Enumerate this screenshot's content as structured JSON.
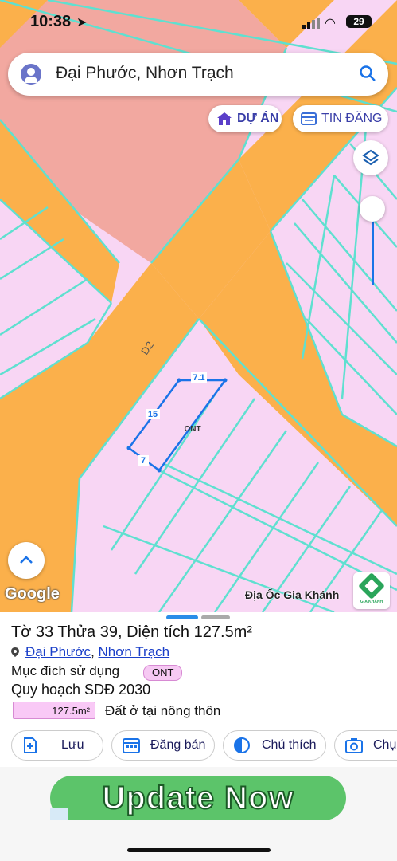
{
  "status_bar": {
    "time": "10:38",
    "battery": "29"
  },
  "search": {
    "query": "Đại Phước, Nhơn Trạch"
  },
  "pills": {
    "project": "DỰ ÁN",
    "listing": "TIN ĐĂNG"
  },
  "map": {
    "road_label": "D2",
    "plot_edges": {
      "top": "7.1",
      "left": "15",
      "bottom": "7"
    },
    "plot_code": "ONT",
    "attribution": "Google",
    "credit": "Địa Ốc Gia Khánh",
    "logo_caption": "GIA KHÁNH"
  },
  "info": {
    "title": "Tờ 33 Thửa 39, Diện tích 127.5m²",
    "ward": "Đại Phước",
    "sep": ",",
    "district": "Nhơn Trạch",
    "purpose_label": "Mục đích sử dụng",
    "purpose_code": "ONT",
    "plan_title": "Quy hoạch SDĐ 2030",
    "area_value": "127.5m²",
    "area_type": "Đất ở tại nông thôn"
  },
  "actions": {
    "save": "Lưu",
    "post": "Đăng bán",
    "legend": "Chú thích",
    "capture": "Chụp"
  },
  "ad": {
    "text": "Update Now"
  },
  "colors": {
    "road": "#fbb04b",
    "residential": "#f8d6f4",
    "commercial": "#f2a8a0",
    "lot_line": "#5fe0d0",
    "accent": "#3a3fa8"
  }
}
